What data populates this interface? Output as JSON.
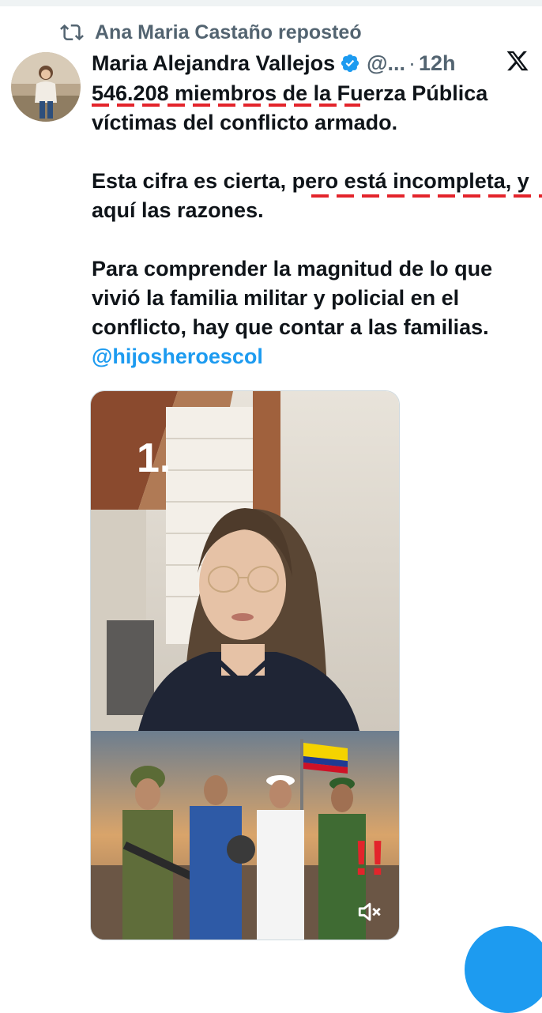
{
  "repost": {
    "text": "Ana Maria Castaño reposteó",
    "icon": "repost-icon"
  },
  "tweet": {
    "author_name": "Maria Alejandra Vallejos",
    "handle": "@...",
    "separator": "·",
    "time": "12h",
    "paragraphs": [
      "546.208 miembros de la Fuerza Pública víctimas del conflicto armado.",
      "Esta cifra es cierta, pero está incompleta, y aquí las razones.",
      "Para comprender la magnitud de lo que vivió la familia militar y policial en el conflicto, hay que contar a las familias."
    ],
    "mention": "@hijosheroescol"
  },
  "media": {
    "overlay_number": "1.",
    "exclamation": "!!"
  },
  "colors": {
    "accent": "#1d9bf0",
    "annotation_red": "#e3242b",
    "secondary_text": "#536471"
  }
}
